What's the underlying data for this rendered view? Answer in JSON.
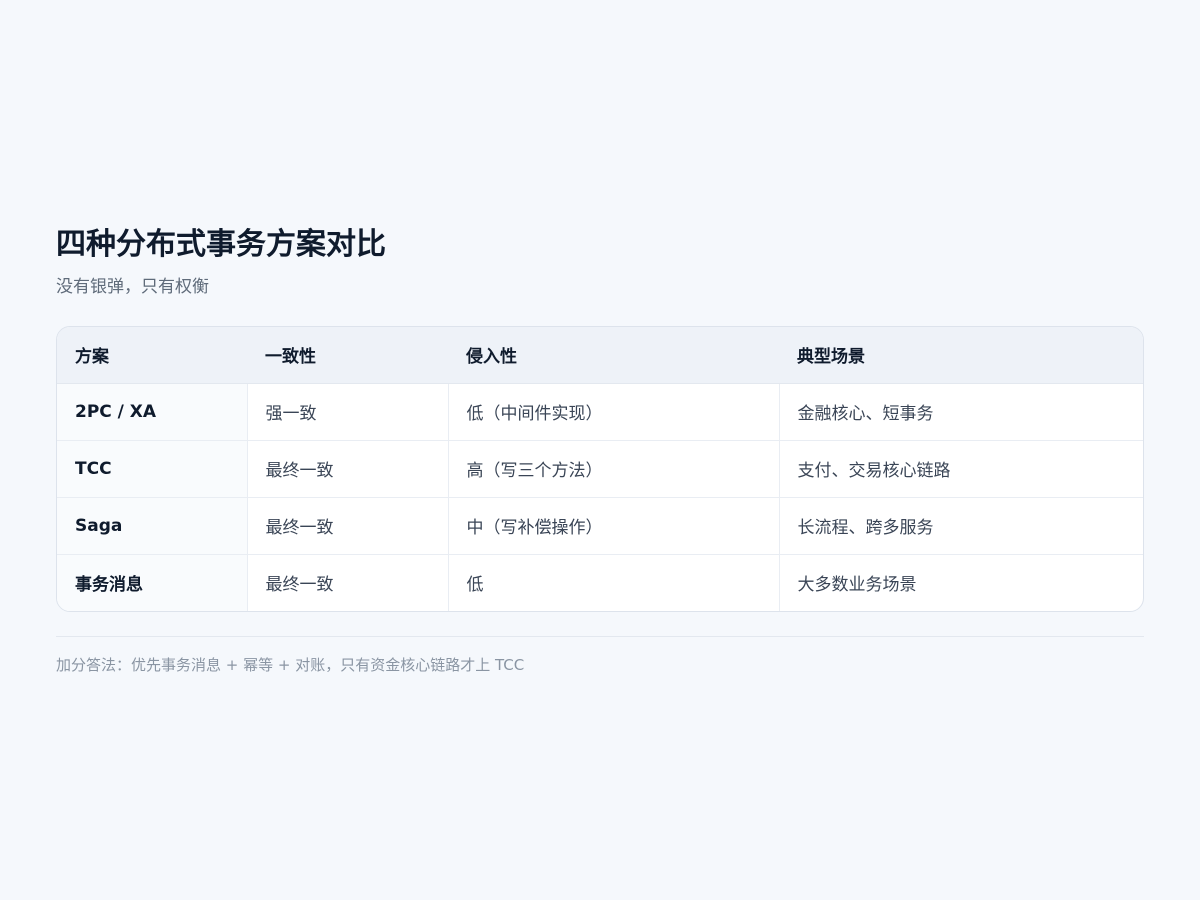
{
  "title": "四种分布式事务方案对比",
  "subtitle": "没有银弹，只有权衡",
  "table": {
    "headers": [
      "方案",
      "一致性",
      "侵入性",
      "典型场景"
    ],
    "rows": [
      [
        "2PC / XA",
        "强一致",
        "低（中间件实现）",
        "金融核心、短事务"
      ],
      [
        "TCC",
        "最终一致",
        "高（写三个方法）",
        "支付、交易核心链路"
      ],
      [
        "Saga",
        "最终一致",
        "中（写补偿操作）",
        "长流程、跨多服务"
      ],
      [
        "事务消息",
        "最终一致",
        "低",
        "大多数业务场景"
      ]
    ]
  },
  "footnote": "加分答法：优先事务消息 + 幂等 + 对账，只有资金核心链路才上 TCC"
}
